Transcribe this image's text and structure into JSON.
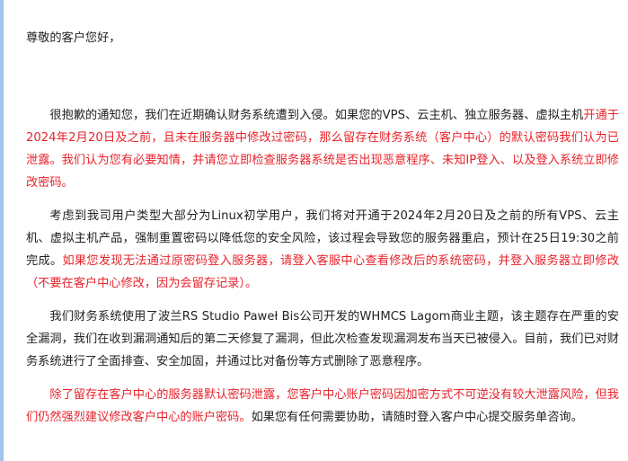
{
  "greeting": "尊敬的客户您好，",
  "paragraphs": [
    {
      "segments": [
        {
          "text": "很抱歉的通知您，我们在近期确认财务系统遭到入侵。如果您的VPS、云主机、独立服务器、虚拟主机",
          "red": false
        },
        {
          "text": "开通于2024年2月20日及之前，且未在服务器中修改过密码，那么留存在财务系统（客户中心）的默认密码我们认为已泄露。我们认为您有必要知情，并请您立即检查服务器系统是否出现恶意程序、未知IP登入、以及登入系统立即修改密码。",
          "red": true
        }
      ]
    },
    {
      "segments": [
        {
          "text": "考虑到我司用户类型大部分为Linux初学用户，我们将对开通于2024年2月20日及之前的所有VPS、云主机、虚拟主机产品，强制重置密码以降低您的安全风险，该过程会导致您的服务器重启，预计在25日19:30之前完成。",
          "red": false
        },
        {
          "text": "如果您发现无法通过原密码登入服务器，请登入客服中心查看修改后的系统密码，并登入服务器立即修改（不要在客户中心修改，因为会留存记录）。",
          "red": true
        }
      ]
    },
    {
      "segments": [
        {
          "text": "我们财务系统使用了波兰RS Studio Paweł Bis公司开发的WHMCS Lagom商业主题，该主题存在严重的安全漏洞，我们在收到漏洞通知后的第二天修复了漏洞，但此次检查发现漏洞发布当天已被侵入。目前，我们已对财务系统进行了全面排查、安全加固，并通过比对备份等方式删除了恶意程序。",
          "red": false
        }
      ]
    },
    {
      "segments": [
        {
          "text": "除了留存在客户中心的服务器默认密码泄露，您客户中心账户密码因加密方式不可逆没有较大泄露风险，但我们仍然强烈建议修改客户中心的账户密码。",
          "red": true
        },
        {
          "text": "如果您有任何需要协助，请随时登入客户中心提交服务单咨询。",
          "red": false
        }
      ]
    }
  ],
  "colors": {
    "text": "#222222",
    "highlight": "#e8232b",
    "left_bar": "#9fc3ec"
  }
}
